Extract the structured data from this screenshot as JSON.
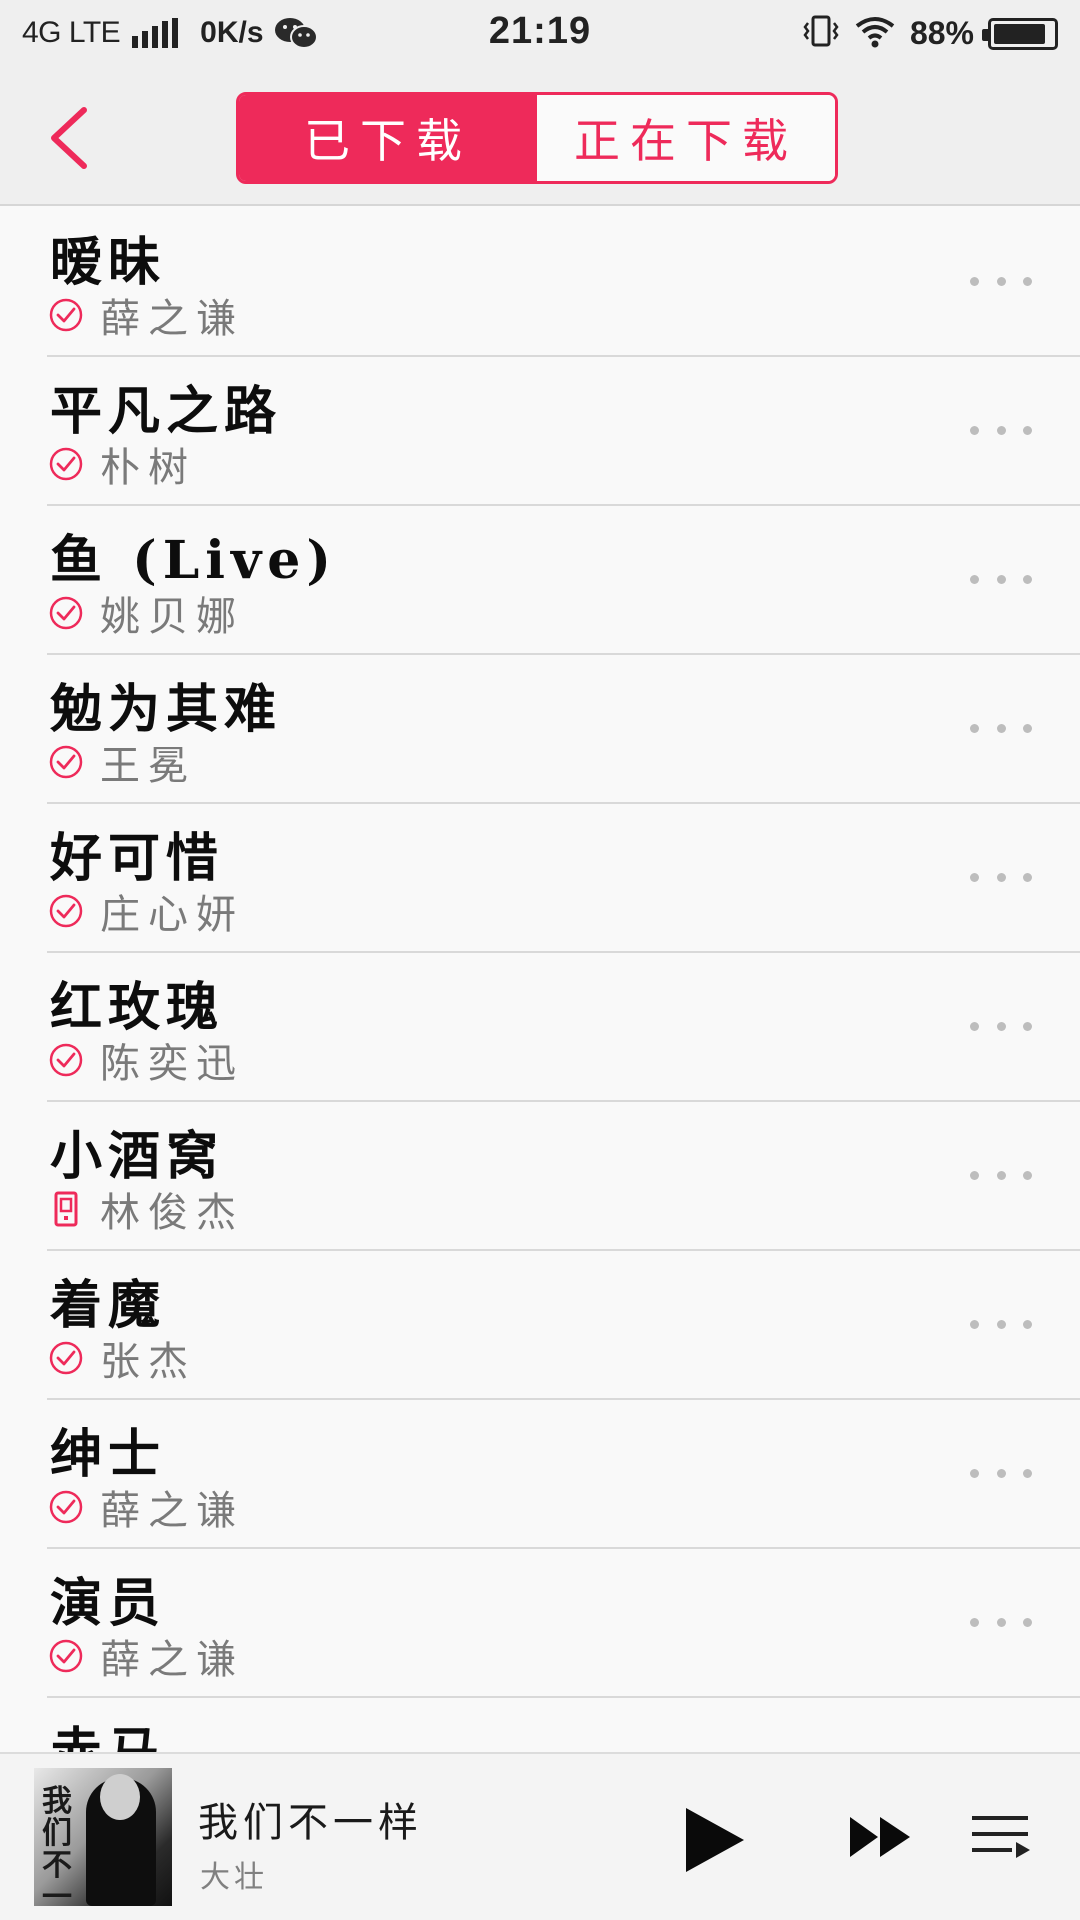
{
  "status_bar": {
    "network": "4G LTE",
    "speed": "0K/s",
    "time": "21:19",
    "battery": "88%",
    "battery_level": 0.88
  },
  "header": {
    "tabs": [
      {
        "label": "已下载",
        "active": true
      },
      {
        "label": "正在下载",
        "active": false
      }
    ]
  },
  "songs": [
    {
      "title": "暧昧",
      "artist": "薛之谦",
      "status": "downloaded"
    },
    {
      "title": "平凡之路",
      "artist": "朴树",
      "status": "downloaded"
    },
    {
      "title": "鱼 (Live)",
      "artist": "姚贝娜",
      "status": "downloaded"
    },
    {
      "title": "勉为其难",
      "artist": "王冕",
      "status": "downloaded"
    },
    {
      "title": "好可惜",
      "artist": "庄心妍",
      "status": "downloaded"
    },
    {
      "title": "红玫瑰",
      "artist": "陈奕迅",
      "status": "downloaded"
    },
    {
      "title": "小酒窝",
      "artist": "林俊杰",
      "status": "local"
    },
    {
      "title": "着魔",
      "artist": "张杰",
      "status": "downloaded"
    },
    {
      "title": "绅士",
      "artist": "薛之谦",
      "status": "downloaded"
    },
    {
      "title": "演员",
      "artist": "薛之谦",
      "status": "downloaded"
    },
    {
      "title": "赤马",
      "artist": "",
      "status": "downloaded"
    }
  ],
  "player": {
    "title": "我们不一样",
    "artist": "大壮",
    "cover_text": "我们不一样"
  },
  "colors": {
    "accent": "#ee2a5a",
    "background": "#f9f9f9",
    "bar_background": "#efefef"
  }
}
